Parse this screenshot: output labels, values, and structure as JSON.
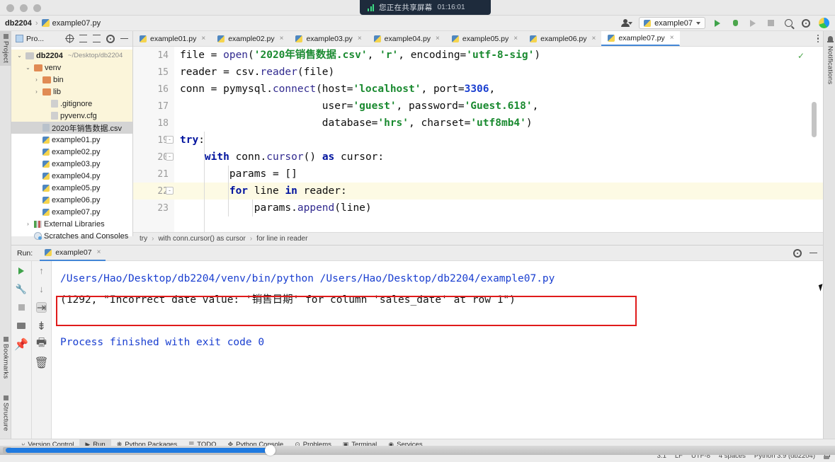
{
  "window": {
    "share_banner": {
      "text": "您正在共享屏幕",
      "time": "01:16:01",
      "icon": "signal-bars-icon"
    },
    "breadcrumb": {
      "project": "db2204",
      "separator": "›",
      "file": "example07.py"
    }
  },
  "toolbar": {
    "run_config": "example07",
    "icons": [
      "avatar-icon",
      "run-icon",
      "debug-icon",
      "coverage-icon",
      "stop-icon",
      "search-icon",
      "settings-icon",
      "ide-logo-icon"
    ]
  },
  "left_strip": {
    "top": "Project",
    "bottom": [
      "Bookmarks",
      "Structure"
    ]
  },
  "right_strip": {
    "notifications": "Notifications"
  },
  "project_panel": {
    "title": "Pro...",
    "tools": [
      "target-icon",
      "collapse-all-icon",
      "expand-all-icon",
      "gear-icon",
      "minimize-icon"
    ],
    "tree": [
      {
        "label": "db2204",
        "path": "~/Desktop/db2204",
        "indent": 0,
        "icon": "folder-icon",
        "twisty": "v",
        "bold": true,
        "state": "highlight"
      },
      {
        "label": "venv",
        "path": "",
        "indent": 1,
        "icon": "folder-orange-icon",
        "twisty": "v",
        "bold": false,
        "state": "highlight"
      },
      {
        "label": "bin",
        "path": "",
        "indent": 2,
        "icon": "folder-orange-icon",
        "twisty": ">",
        "bold": false,
        "state": "highlight"
      },
      {
        "label": "lib",
        "path": "",
        "indent": 2,
        "icon": "folder-orange-icon",
        "twisty": ">",
        "bold": false,
        "state": "highlight"
      },
      {
        "label": ".gitignore",
        "path": "",
        "indent": 3,
        "icon": "gitignore-file-icon",
        "twisty": "",
        "bold": false,
        "state": "highlight"
      },
      {
        "label": "pyvenv.cfg",
        "path": "",
        "indent": 3,
        "icon": "config-file-icon",
        "twisty": "",
        "bold": false,
        "state": "highlight"
      },
      {
        "label": "2020年销售数据.csv",
        "path": "",
        "indent": 2,
        "icon": "csv-file-icon",
        "twisty": "",
        "bold": false,
        "state": "selected"
      },
      {
        "label": "example01.py",
        "path": "",
        "indent": 2,
        "icon": "python-file-icon",
        "twisty": "",
        "bold": false,
        "state": ""
      },
      {
        "label": "example02.py",
        "path": "",
        "indent": 2,
        "icon": "python-file-icon",
        "twisty": "",
        "bold": false,
        "state": ""
      },
      {
        "label": "example03.py",
        "path": "",
        "indent": 2,
        "icon": "python-file-icon",
        "twisty": "",
        "bold": false,
        "state": ""
      },
      {
        "label": "example04.py",
        "path": "",
        "indent": 2,
        "icon": "python-file-icon",
        "twisty": "",
        "bold": false,
        "state": ""
      },
      {
        "label": "example05.py",
        "path": "",
        "indent": 2,
        "icon": "python-file-icon",
        "twisty": "",
        "bold": false,
        "state": ""
      },
      {
        "label": "example06.py",
        "path": "",
        "indent": 2,
        "icon": "python-file-icon",
        "twisty": "",
        "bold": false,
        "state": ""
      },
      {
        "label": "example07.py",
        "path": "",
        "indent": 2,
        "icon": "python-file-icon",
        "twisty": "",
        "bold": false,
        "state": ""
      },
      {
        "label": "External Libraries",
        "path": "",
        "indent": 1,
        "icon": "libraries-icon",
        "twisty": ">",
        "bold": false,
        "state": ""
      },
      {
        "label": "Scratches and Consoles",
        "path": "",
        "indent": 1,
        "icon": "scratches-icon",
        "twisty": "",
        "bold": false,
        "state": ""
      }
    ]
  },
  "editor": {
    "tabs": [
      {
        "label": "example01.py",
        "active": false
      },
      {
        "label": "example02.py",
        "active": false
      },
      {
        "label": "example03.py",
        "active": false
      },
      {
        "label": "example04.py",
        "active": false
      },
      {
        "label": "example05.py",
        "active": false
      },
      {
        "label": "example06.py",
        "active": false
      },
      {
        "label": "example07.py",
        "active": true
      }
    ],
    "close_glyph": "×",
    "lines": [
      {
        "num": "14",
        "highlight": false,
        "fold": ""
      },
      {
        "num": "15",
        "highlight": false,
        "fold": ""
      },
      {
        "num": "16",
        "highlight": false,
        "fold": ""
      },
      {
        "num": "17",
        "highlight": false,
        "fold": ""
      },
      {
        "num": "18",
        "highlight": false,
        "fold": ""
      },
      {
        "num": "19",
        "highlight": false,
        "fold": "-"
      },
      {
        "num": "20",
        "highlight": false,
        "fold": "-"
      },
      {
        "num": "21",
        "highlight": false,
        "fold": ""
      },
      {
        "num": "22",
        "highlight": true,
        "fold": "-"
      },
      {
        "num": "23",
        "highlight": false,
        "fold": ""
      }
    ],
    "code": [
      "file = open('2020年销售数据.csv', 'r', encoding='utf-8-sig')",
      "reader = csv.reader(file)",
      "conn = pymysql.connect(host='localhost', port=3306,",
      "                       user='guest', password='Guest.618',",
      "                       database='hrs', charset='utf8mb4')",
      "try:",
      "    with conn.cursor() as cursor:",
      "        params = []",
      "        for line in reader:",
      "            params.append(line)"
    ],
    "inspection_ok": "✓",
    "breadcrumb": [
      "try",
      "with conn.cursor() as cursor",
      "for line in reader"
    ],
    "breadcrumb_separator": "›"
  },
  "run_window": {
    "label": "Run:",
    "tab": "example07",
    "close_glyph": "×",
    "toolbar_left": [
      "rerun-icon",
      "wrench-icon",
      "stop-icon",
      "console-icon",
      "pin-icon"
    ],
    "toolbar_right": [
      "arrow-up-icon",
      "arrow-down-icon",
      "soft-wrap-icon",
      "scroll-to-end-icon",
      "print-icon",
      "trash-icon"
    ],
    "header_right": [
      "gear-icon",
      "minimize-icon"
    ],
    "output": [
      {
        "text": "/Users/Hao/Desktop/db2204/venv/bin/python /Users/Hao/Desktop/db2204/example07.py",
        "type": "path"
      },
      {
        "text": "(1292, \"Incorrect date value: '销售日期' for column 'sales_date' at row 1\")",
        "type": "error"
      },
      {
        "text": "",
        "type": "blank"
      },
      {
        "text": "Process finished with exit code 0",
        "type": "path"
      }
    ],
    "annotation_color": "#e01b1b"
  },
  "bottom_bar": {
    "items": [
      {
        "label": "Version Control",
        "icon": "branch-icon",
        "selected": false
      },
      {
        "label": "Run",
        "icon": "run-icon",
        "selected": true
      },
      {
        "label": "Python Packages",
        "icon": "packages-icon",
        "selected": false
      },
      {
        "label": "TODO",
        "icon": "todo-icon",
        "selected": false
      },
      {
        "label": "Python Console",
        "icon": "console-icon",
        "selected": false
      },
      {
        "label": "Problems",
        "icon": "problems-icon",
        "selected": false
      },
      {
        "label": "Terminal",
        "icon": "terminal-icon",
        "selected": false
      },
      {
        "label": "Services",
        "icon": "services-icon",
        "selected": false
      }
    ]
  },
  "status_bar": {
    "position": "3.1",
    "line_separator": "LF",
    "encoding": "UTF-8",
    "indent": "4 spaces",
    "interpreter": "Python 3.9 (db2204)",
    "lock": "lock-icon"
  }
}
